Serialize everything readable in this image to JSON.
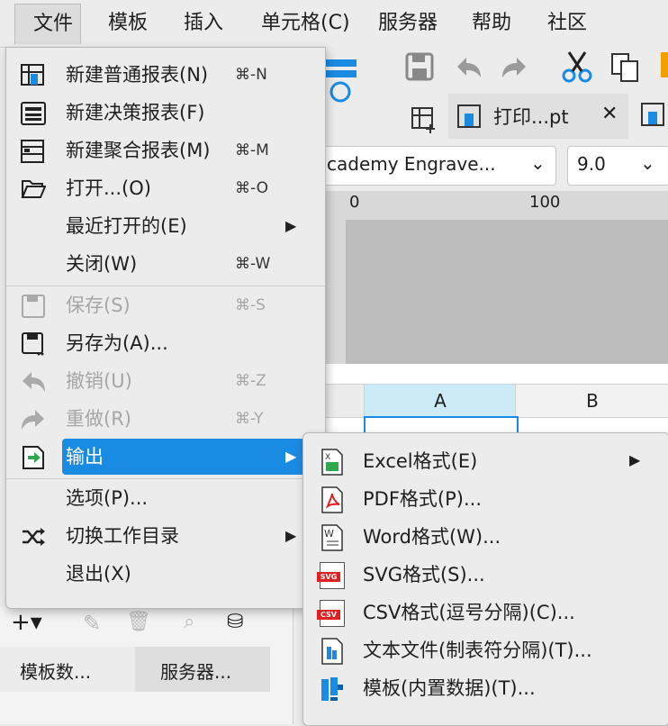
{
  "menubar": {
    "items": [
      "文件",
      "模板",
      "插入",
      "单元格(C)",
      "服务器",
      "帮助",
      "社区"
    ]
  },
  "file_menu": {
    "items": [
      {
        "label": "新建普通报表(N)",
        "shortcut": "⌘-N",
        "icon": "grid-report-icon"
      },
      {
        "label": "新建决策报表(F)",
        "shortcut": "",
        "icon": "dashboard-report-icon"
      },
      {
        "label": "新建聚合报表(M)",
        "shortcut": "⌘-M",
        "icon": "aggregate-report-icon"
      },
      {
        "label": "打开...(O)",
        "shortcut": "⌘-O",
        "icon": "folder-open-icon"
      },
      {
        "label": "最近打开的(E)",
        "shortcut": "",
        "submenu": true
      },
      {
        "label": "关闭(W)",
        "shortcut": "⌘-W"
      },
      {
        "label": "保存(S)",
        "shortcut": "⌘-S",
        "icon": "save-icon",
        "disabled": true
      },
      {
        "label": "另存为(A)...",
        "shortcut": "",
        "icon": "save-as-icon"
      },
      {
        "label": "撤销(U)",
        "shortcut": "⌘-Z",
        "icon": "undo-icon",
        "disabled": true
      },
      {
        "label": "重做(R)",
        "shortcut": "⌘-Y",
        "icon": "redo-icon",
        "disabled": true
      },
      {
        "label": "输出",
        "shortcut": "",
        "icon": "export-icon",
        "submenu": true,
        "selected": true
      },
      {
        "label": "选项(P)...",
        "shortcut": ""
      },
      {
        "label": "切换工作目录",
        "shortcut": "",
        "icon": "shuffle-icon",
        "submenu": true
      },
      {
        "label": "退出(X)",
        "shortcut": ""
      }
    ]
  },
  "export_submenu": {
    "items": [
      {
        "label": "Excel格式(E)",
        "icon": "excel-file-icon",
        "submenu": true
      },
      {
        "label": "PDF格式(P)...",
        "icon": "pdf-file-icon"
      },
      {
        "label": "Word格式(W)...",
        "icon": "word-file-icon"
      },
      {
        "label": "SVG格式(S)...",
        "icon": "svg-file-icon",
        "tag": "SVG"
      },
      {
        "label": "CSV格式(逗号分隔)(C)...",
        "icon": "csv-file-icon",
        "tag": "CSV"
      },
      {
        "label": "文本文件(制表符分隔)(T)...",
        "icon": "text-file-icon"
      },
      {
        "label": "模板(内置数据)(T)...",
        "icon": "template-icon"
      }
    ]
  },
  "toolbar": {
    "tab_label": "打印...pt",
    "font_name": "cademy Engrave...",
    "font_size": "9.0"
  },
  "ruler": {
    "marks": [
      "0",
      "100"
    ]
  },
  "sheet": {
    "columns": [
      "A",
      "B"
    ]
  },
  "bottom_panel": {
    "tabs": [
      "模板数...",
      "服务器..."
    ]
  },
  "colors": {
    "accent": "#1a8be2",
    "column_selected": "#cdeaf7"
  }
}
